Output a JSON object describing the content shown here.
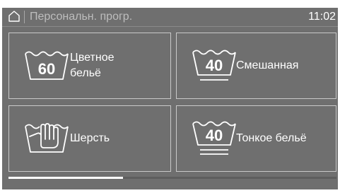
{
  "header": {
    "home_icon": "home-icon",
    "title": "Персональн. прогр.",
    "time": "11:02"
  },
  "programs": [
    {
      "label": "Цветное\nбельё",
      "temperature": "60",
      "icon": "wash-tub-60-icon"
    },
    {
      "label": "Смешанная",
      "temperature": "40",
      "icon": "wash-tub-40-one-bar-icon"
    },
    {
      "label": "Шерсть",
      "temperature": "",
      "icon": "hand-wash-icon"
    },
    {
      "label": "Тонкое бельё",
      "temperature": "40",
      "icon": "wash-tub-40-two-bars-icon"
    }
  ],
  "scroll": {
    "position_fraction": 0.35
  },
  "colors": {
    "background": "#6f6f6f",
    "text": "#ffffff",
    "title_text": "#bdbdbd",
    "border": "#c9c9c9"
  }
}
